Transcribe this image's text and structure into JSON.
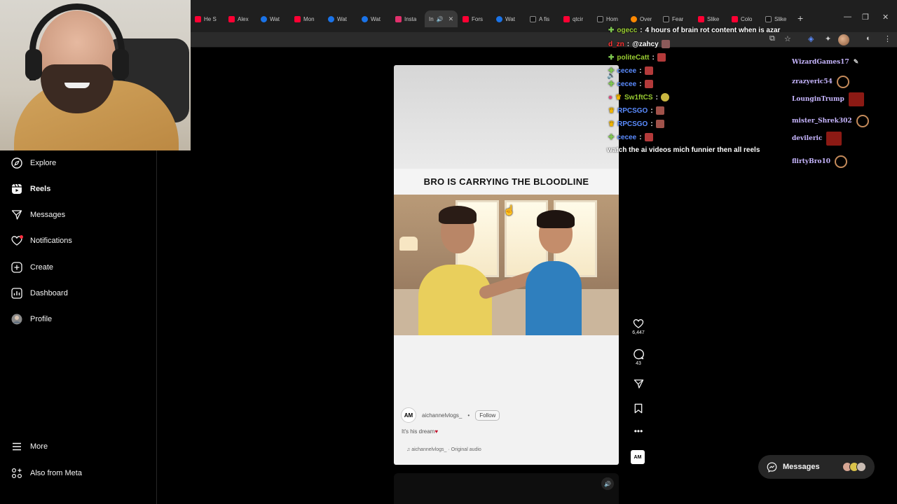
{
  "browser": {
    "tabs": [
      {
        "label": "He S",
        "color": "#ff0033"
      },
      {
        "label": "Alex",
        "color": "#ff0033"
      },
      {
        "label": "Wat",
        "color": "#1a73e8"
      },
      {
        "label": "Mon",
        "color": "#ff0033"
      },
      {
        "label": "Wat",
        "color": "#1a73e8"
      },
      {
        "label": "Wat",
        "color": "#1a73e8"
      },
      {
        "label": "Insta",
        "color": "#e1306c"
      },
      {
        "label": "In",
        "color": "#e1306c"
      },
      {
        "label": "Fors",
        "color": "#ff0033"
      },
      {
        "label": "Wat",
        "color": "#1a73e8"
      },
      {
        "label": "A fis",
        "color": "#111111"
      },
      {
        "label": "qtcir",
        "color": "#ff0033"
      },
      {
        "label": "Hom",
        "color": "#111111"
      },
      {
        "label": "Over",
        "color": "#ff8800"
      },
      {
        "label": "Fear",
        "color": "#111111"
      },
      {
        "label": "Slike",
        "color": "#ff0033"
      },
      {
        "label": "Colo",
        "color": "#ff0033"
      },
      {
        "label": "Slike",
        "color": "#111111"
      }
    ],
    "new_tab": "+"
  },
  "sidebar": {
    "items": [
      {
        "label": "Explore",
        "icon": "compass-icon"
      },
      {
        "label": "Reels",
        "icon": "reels-icon"
      },
      {
        "label": "Messages",
        "icon": "send-icon"
      },
      {
        "label": "Notifications",
        "icon": "heart-icon"
      },
      {
        "label": "Create",
        "icon": "plus-square-icon"
      },
      {
        "label": "Dashboard",
        "icon": "dashboard-icon"
      },
      {
        "label": "Profile",
        "icon": "profile-avatar"
      }
    ],
    "more": "More",
    "also_from_meta": "Also from Meta"
  },
  "reel": {
    "title": "BRO IS CARRYING THE BLOODLINE",
    "username": "aichannelvlogs_",
    "separator": "•",
    "follow": "Follow",
    "description": "It's his dream",
    "audio": "aichannelvlogs_ · Original audio",
    "avatar_text": "AM",
    "likes": "6,447",
    "comments": "43"
  },
  "chat": [
    {
      "user": "ogecc",
      "text": "4 hours of brain rot content when is azar",
      "color": "#9acd32"
    },
    {
      "user": "d_zn",
      "text": "@zahcy",
      "color": "#ff3333"
    },
    {
      "user": "politeCatt",
      "text": "",
      "color": "#9acd32"
    },
    {
      "user": "cecee",
      "text": "",
      "color": "#5b8cff"
    },
    {
      "user": "cecee",
      "text": "",
      "color": "#5b8cff"
    },
    {
      "user": "Sw1ftCS",
      "text": "",
      "color": "#9acd32"
    },
    {
      "user": "RPCSGO",
      "text": "",
      "color": "#5b8cff"
    },
    {
      "user": "RPCSGO",
      "text": "",
      "color": "#5b8cff"
    },
    {
      "user": "cecee",
      "text": "",
      "color": "#5b8cff"
    }
  ],
  "chat_plain": "watch the ai videos mich funnier then all reels",
  "viewers": [
    "WizardGames17",
    "zrazyeric54",
    "LounginTrump",
    "mister_Shrek302",
    "devileric",
    "flirtyBro10"
  ],
  "messages_pill": {
    "label": "Messages"
  },
  "colors": {
    "background": "#000000",
    "sidebar_border": "#262626",
    "notification_dot": "#ff3040"
  }
}
